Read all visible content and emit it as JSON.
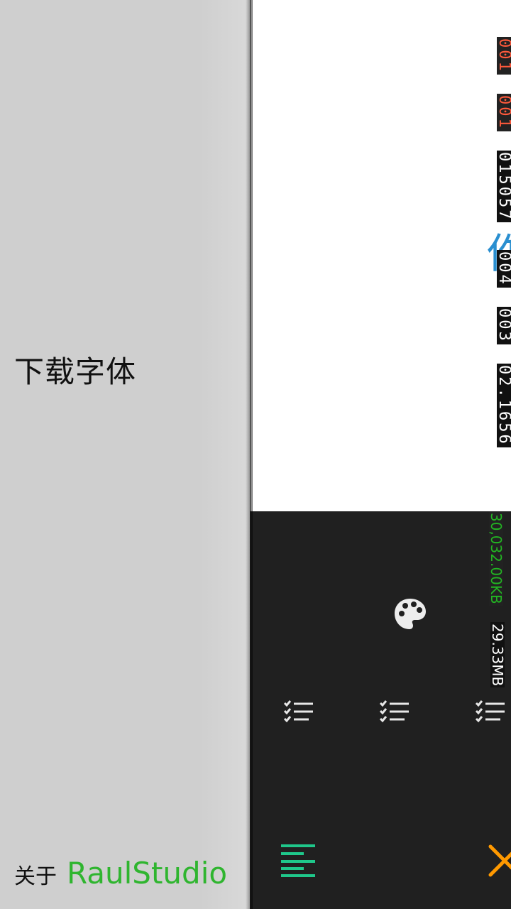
{
  "drawer": {
    "menu_item": "下载字体",
    "about_label": "关于",
    "about_brand": "RaulStudio"
  },
  "preview": {
    "char": "作",
    "labels": [
      "001",
      "001",
      "015057",
      "004",
      "003",
      "02.1656"
    ]
  },
  "status": {
    "size_kb": "30,032.00KB",
    "size_mb": "29.33MB"
  },
  "toolbar": {
    "palette": "palette-icon",
    "lists": [
      "checklist-icon",
      "checklist-icon",
      "checklist-icon"
    ],
    "align": "align-left-icon",
    "close": "close-icon"
  },
  "colors": {
    "accent_green": "#2fb52f",
    "accent_teal": "#1fc78a",
    "accent_orange": "#ff9900",
    "preview_blue": "#2a8fd0"
  }
}
